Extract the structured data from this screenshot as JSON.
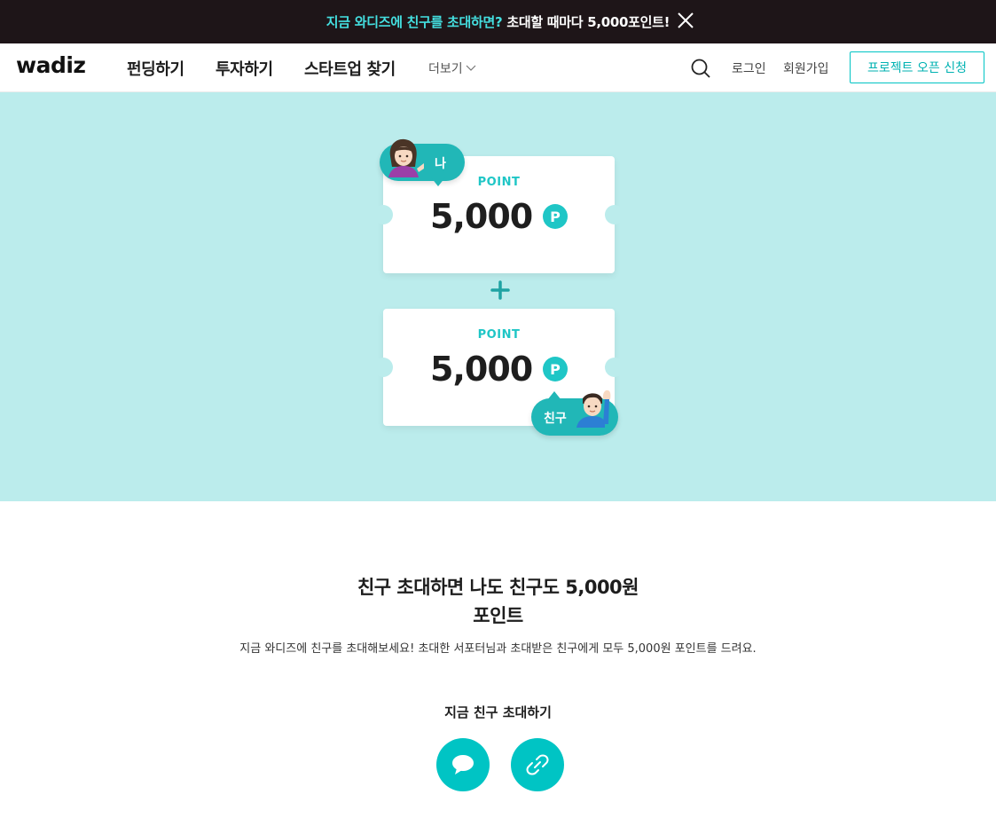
{
  "banner": {
    "highlight": "지금 와디즈에 친구를 초대하면?",
    "text": " 초대할 때마다 5,000포인트!",
    "close_icon": "close-icon"
  },
  "nav": {
    "logo": "wadiz",
    "items": [
      "펀딩하기",
      "투자하기",
      "스타트업 찾기"
    ],
    "more": "더보기",
    "search_icon": "search-icon",
    "login": "로그인",
    "signup": "회원가입",
    "cta": "프로젝트 오픈 신청"
  },
  "hero": {
    "tickets": [
      {
        "label": "POINT",
        "amount": "5,000",
        "coin": "P",
        "bubble": "나"
      },
      {
        "label": "POINT",
        "amount": "5,000",
        "coin": "P",
        "bubble": "친구"
      }
    ]
  },
  "content": {
    "title_line1": "친구 초대하면 나도 친구도 5,000원",
    "title_line2": "포인트",
    "description": "지금 와디즈에 친구를 초대해보세요! 초대한 서포터님과 초대받은 친구에게 모두 5,000원 포인트를 드려요.",
    "invite_label": "지금 친구 초대하기",
    "share_buttons": [
      "chat-bubble-icon",
      "link-icon"
    ]
  },
  "colors": {
    "accent": "#00c4c4",
    "hero_bg": "#bbecec",
    "banner_bg": "#1e1518",
    "banner_highlight": "#44dfe0"
  }
}
